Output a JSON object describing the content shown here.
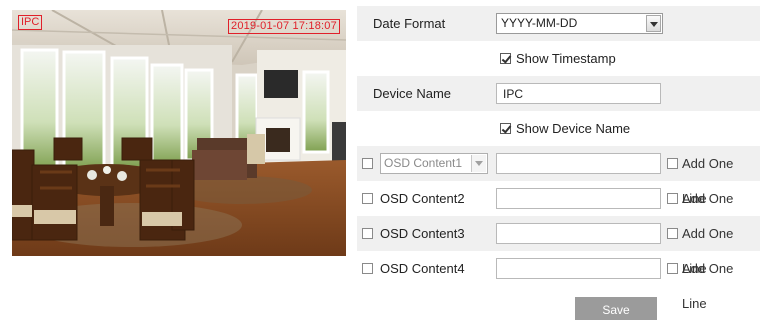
{
  "preview": {
    "osd_name": "IPC",
    "osd_timestamp": "2019-01-07 17:18:07"
  },
  "form": {
    "date_format_label": "Date Format",
    "date_format_value": "YYYY-MM-DD",
    "show_timestamp_label": "Show Timestamp",
    "show_timestamp_checked": true,
    "device_name_label": "Device Name",
    "device_name_value": "IPC",
    "show_device_name_label": "Show Device Name",
    "show_device_name_checked": true,
    "osd_content1_option": "OSD Content1",
    "osd_content2_label": "OSD Content2",
    "osd_content3_label": "OSD Content3",
    "osd_content4_label": "OSD Content4",
    "add_one_line_label": "Add One Line",
    "save_label": "Save"
  },
  "colors": {
    "osd_red": "#e0202a",
    "shade_row": "#f0f0f0",
    "save_button": "#9b9b9b"
  }
}
